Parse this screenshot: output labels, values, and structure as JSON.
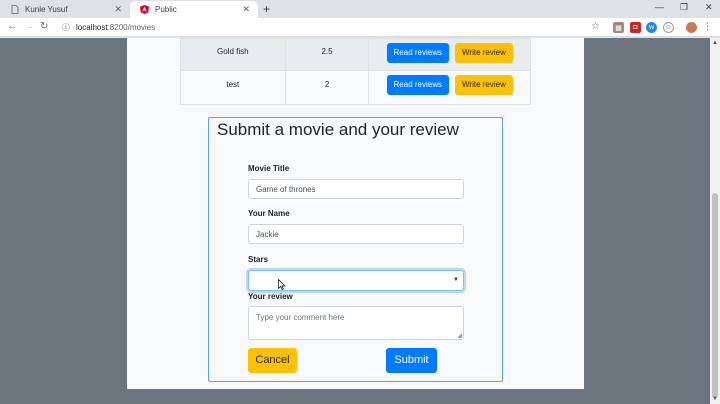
{
  "tabs": [
    {
      "title": "Kunle Yusuf",
      "icon": "document-icon",
      "active": false
    },
    {
      "title": "Public",
      "icon": "angular-icon",
      "active": true
    }
  ],
  "toolbar": {
    "url_host": "localhost",
    "url_path": ":8200/movies"
  },
  "table": {
    "rows": [
      {
        "title": "Gold fish",
        "stars": "2.5",
        "read_label": "Read reviews",
        "write_label": "Write review"
      },
      {
        "title": "test",
        "stars": "2",
        "read_label": "Read reviews",
        "write_label": "Write review"
      }
    ]
  },
  "form": {
    "title": "Submit a movie and your review",
    "movie_title_label": "Movie Title",
    "movie_title_value": "Game of thrones",
    "name_label": "Your Name",
    "name_value": "Jackie",
    "stars_label": "Stars",
    "stars_value": "",
    "review_label": "Your review",
    "review_placeholder": "Type your comment here",
    "cancel_label": "Cancel",
    "submit_label": "Submit"
  },
  "colors": {
    "primary": "#007bff",
    "warning": "#ffc107",
    "page_bg": "#6c757d",
    "card_bg": "#f8f9fa"
  }
}
